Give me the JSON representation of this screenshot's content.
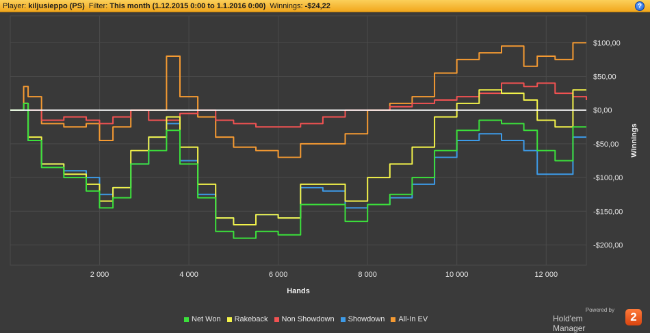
{
  "header": {
    "player_label": "Player:",
    "player_value": "kiljusieppo (PS)",
    "filter_label": "Filter:",
    "filter_value": "This month (1.12.2015 0:00 to 1.1.2016 0:00)",
    "winnings_label": "Winnings:",
    "winnings_value": "-$24,22"
  },
  "help_label": "?",
  "branding": {
    "powered_by": "Powered by",
    "product": "Hold'em Manager",
    "logo": "2"
  },
  "colors": {
    "net_won": "#3be03b",
    "rakeback": "#f3f34a",
    "non_showdown": "#f25252",
    "showdown": "#3d9be8",
    "allin_ev": "#f59a32",
    "background": "#3a3a3a",
    "zero_line": "#ffffff"
  },
  "chart_data": {
    "type": "line",
    "xlabel": "Hands",
    "ylabel": "Winnings",
    "xlim": [
      0,
      12900
    ],
    "ylim": [
      -230,
      140
    ],
    "x_ticks": [
      2000,
      4000,
      6000,
      8000,
      10000,
      12000
    ],
    "x_tick_labels": [
      "2 000",
      "4 000",
      "6 000",
      "8 000",
      "10 000",
      "12 000"
    ],
    "y_ticks": [
      100,
      50,
      0,
      -50,
      -100,
      -150,
      -200
    ],
    "y_tick_labels": [
      "$100,00",
      "$50,00",
      "$0,00",
      "-$50,00",
      "-$100,00",
      "-$150,00",
      "-$200,00"
    ],
    "grid": true,
    "legend_position": "bottom",
    "x": [
      0,
      300,
      400,
      700,
      1200,
      1700,
      2000,
      2300,
      2700,
      3100,
      3500,
      3800,
      4200,
      4600,
      5000,
      5500,
      6000,
      6500,
      7000,
      7500,
      8000,
      8500,
      9000,
      9500,
      10000,
      10500,
      11000,
      11500,
      11800,
      12200,
      12600,
      12900
    ],
    "series": [
      {
        "name": "Net Won",
        "values": [
          0,
          10,
          -45,
          -85,
          -100,
          -120,
          -145,
          -130,
          -80,
          -60,
          -30,
          -80,
          -130,
          -180,
          -190,
          -180,
          -185,
          -140,
          -140,
          -165,
          -140,
          -125,
          -100,
          -60,
          -30,
          -15,
          -20,
          -30,
          -60,
          -75,
          -25,
          -25
        ]
      },
      {
        "name": "Rakeback",
        "values": [
          0,
          10,
          -40,
          -80,
          -95,
          -110,
          -135,
          -115,
          -60,
          -40,
          -10,
          -55,
          -110,
          -160,
          -170,
          -155,
          -160,
          -110,
          -110,
          -135,
          -100,
          -80,
          -55,
          -10,
          10,
          30,
          25,
          15,
          -15,
          -25,
          30,
          30
        ]
      },
      {
        "name": "Non Showdown",
        "values": [
          0,
          10,
          0,
          -15,
          -10,
          -15,
          -20,
          -10,
          0,
          -15,
          -15,
          -5,
          0,
          -15,
          -20,
          -25,
          -25,
          -20,
          -10,
          0,
          0,
          5,
          10,
          15,
          20,
          25,
          40,
          35,
          40,
          25,
          20,
          15
        ]
      },
      {
        "name": "Showdown",
        "values": [
          0,
          0,
          -45,
          -80,
          -90,
          -100,
          -125,
          -115,
          -80,
          -40,
          -20,
          -75,
          -125,
          -160,
          -170,
          -155,
          -160,
          -115,
          -120,
          -145,
          -140,
          -130,
          -110,
          -70,
          -45,
          -35,
          -45,
          -60,
          -95,
          -95,
          -40,
          -40
        ]
      },
      {
        "name": "All-In EV",
        "values": [
          0,
          35,
          20,
          -20,
          -25,
          -20,
          -45,
          -25,
          0,
          0,
          80,
          20,
          -10,
          -40,
          -55,
          -60,
          -70,
          -50,
          -50,
          -35,
          0,
          10,
          20,
          55,
          75,
          85,
          95,
          65,
          80,
          75,
          100,
          100
        ]
      }
    ]
  }
}
